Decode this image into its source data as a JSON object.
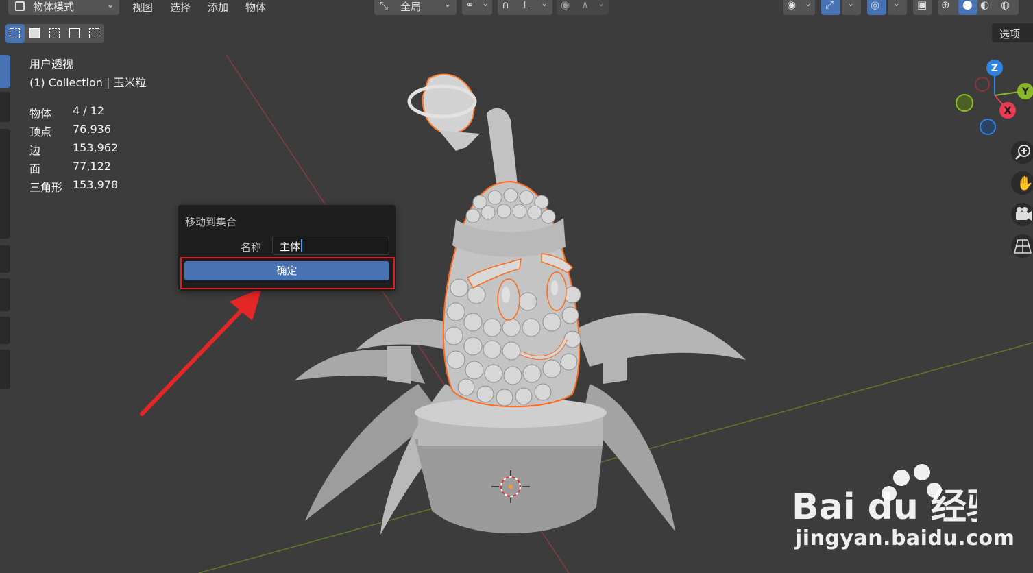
{
  "header": {
    "mode_label": "物体模式",
    "menus": [
      "视图",
      "选择",
      "添加",
      "物体"
    ],
    "transform_orientation": "全局",
    "options_label": "选项"
  },
  "stats": {
    "view_name": "用户透视",
    "collection_line": "(1) Collection | 玉米粒",
    "rows": [
      {
        "label": "物体",
        "value": "4 / 12"
      },
      {
        "label": "顶点",
        "value": "76,936"
      },
      {
        "label": "边",
        "value": "153,962"
      },
      {
        "label": "面",
        "value": "77,122"
      },
      {
        "label": "三角形",
        "value": "153,978"
      }
    ]
  },
  "dialog": {
    "title": "移动到集合",
    "name_label": "名称",
    "name_value": "主体",
    "ok_label": "确定"
  },
  "gizmo": {
    "z": "Z",
    "y": "Y",
    "x": "X",
    "colors": {
      "x": "#e83c55",
      "y": "#8bb929",
      "z": "#2f84e3"
    }
  },
  "watermark": {
    "brand": "Bai du 经验",
    "url": "jingyan.baidu.com"
  },
  "icons": [
    "object-mode-icon",
    "transform-icon",
    "snap-icon",
    "proportional-icon",
    "overlay-icon",
    "shading-icons",
    "zoom-icon",
    "hand-icon",
    "camera-icon",
    "grid-view-icon"
  ]
}
